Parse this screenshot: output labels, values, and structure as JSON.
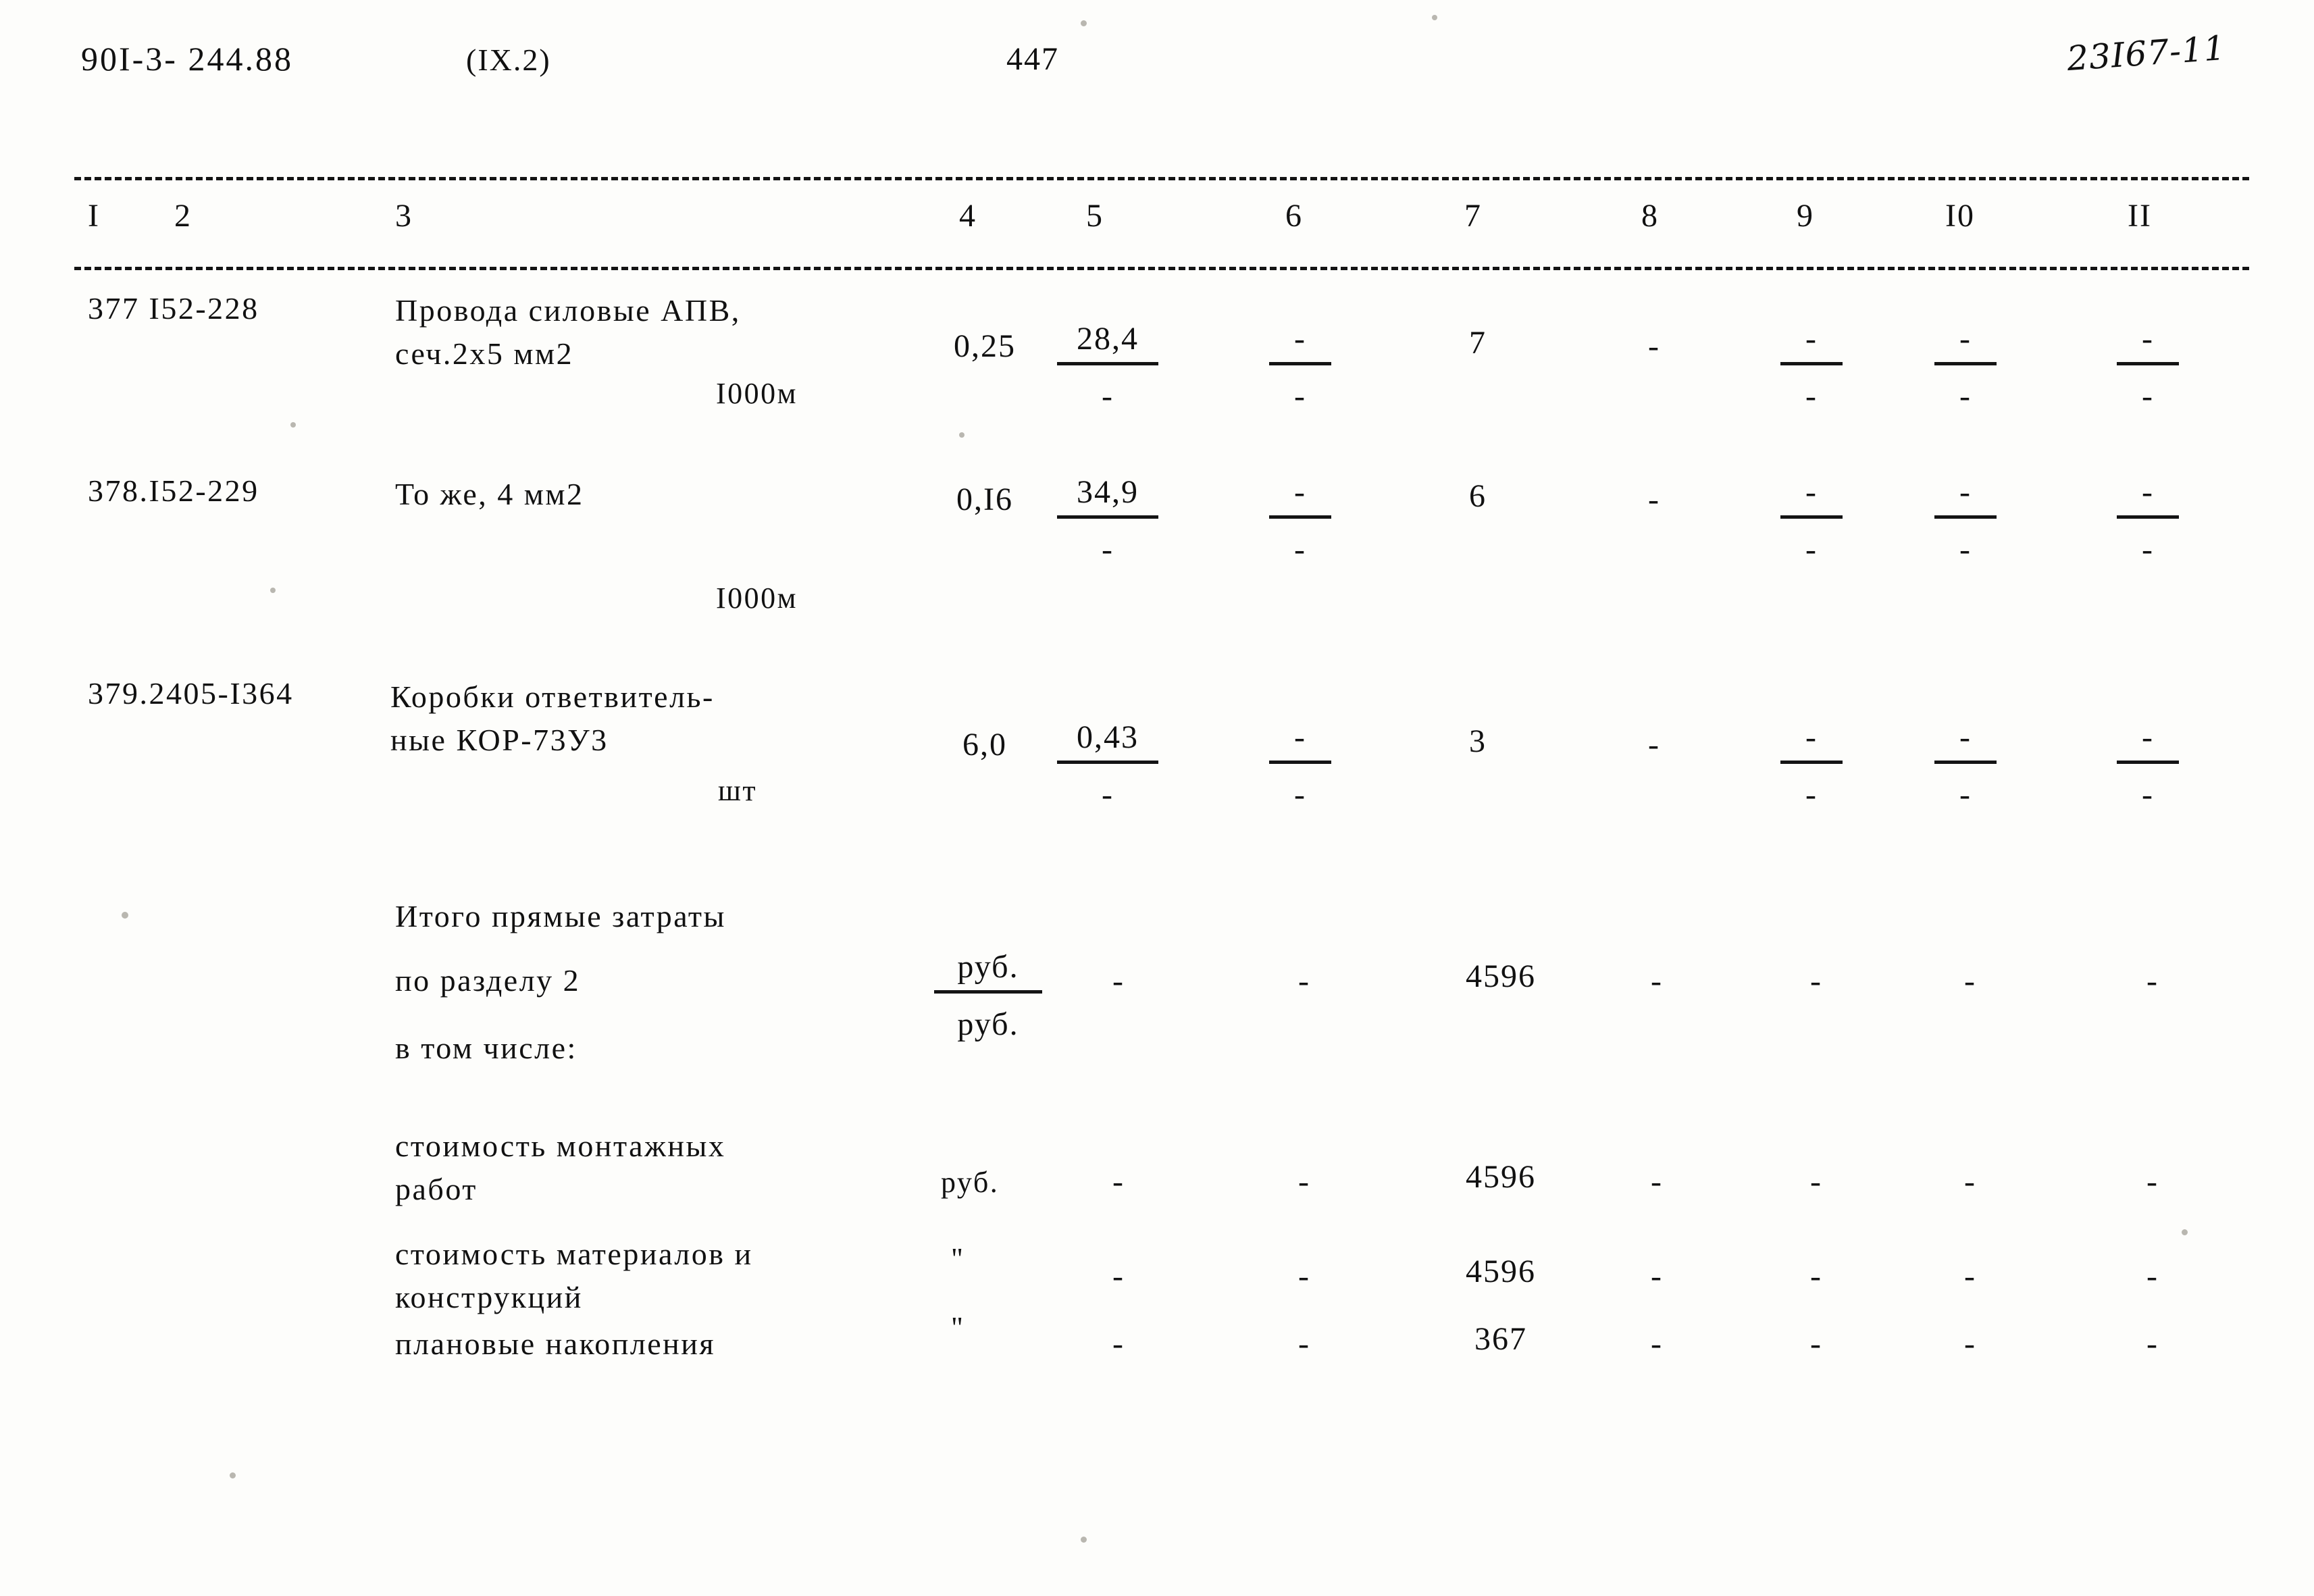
{
  "header": {
    "doc_code": "90I-3- 244.88",
    "section": "(IX.2)",
    "page_number": "447",
    "handwritten_note": "23I67-11"
  },
  "table": {
    "column_headers": [
      "I",
      "2",
      "3",
      "4",
      "5",
      "6",
      "7",
      "8",
      "9",
      "I0",
      "II"
    ],
    "rows": [
      {
        "code": "377 I52-228",
        "description": "Провода силовые АПВ,\nсеч.2х5 мм2",
        "unit": "I000м",
        "col4": "0,25",
        "col5_top": "28,4",
        "col5_bot": "-",
        "col6_top": "-",
        "col6_bot": "-",
        "col7": "7",
        "col8": "-",
        "col9_top": "-",
        "col9_bot": "-",
        "col10_top": "-",
        "col10_bot": "-",
        "col11_top": "-",
        "col11_bot": "-"
      },
      {
        "code": "378.I52-229",
        "description": "То же, 4 мм2",
        "unit": "I000м",
        "col4": "0,I6",
        "col5_top": "34,9",
        "col5_bot": "-",
        "col6_top": "-",
        "col6_bot": "-",
        "col7": "6",
        "col8": "-",
        "col9_top": "-",
        "col9_bot": "-",
        "col10_top": "-",
        "col10_bot": "-",
        "col11_top": "-",
        "col11_bot": "-"
      },
      {
        "code": "379.2405-I364",
        "description": "Коробки ответвитель-\nные КОР-73У3",
        "unit": "шт",
        "col4": "6,0",
        "col5_top": "0,43",
        "col5_bot": "-",
        "col6_top": "-",
        "col6_bot": "-",
        "col7": "3",
        "col8": "-",
        "col9_top": "-",
        "col9_bot": "-",
        "col10_top": "-",
        "col10_bot": "-",
        "col11_top": "-",
        "col11_bot": "-"
      }
    ],
    "summary": {
      "total_label_line1": "Итого прямые затраты",
      "total_label_line2": "по разделу 2",
      "total_unit_top": "руб.",
      "total_unit_bot": "руб.",
      "total_col5": "-",
      "total_col6": "-",
      "total_col7": "4596",
      "total_col8": "-",
      "total_col9": "-",
      "total_col10": "-",
      "total_col11": "-",
      "including_label": "в том числе:",
      "items": [
        {
          "label": "стоимость монтажных\nработ",
          "unit": "руб.",
          "col5": "-",
          "col6": "-",
          "col7": "4596",
          "col8": "-",
          "col9": "-",
          "col10": "-",
          "col11": "-"
        },
        {
          "label": "стоимость материалов и\nконструкций",
          "unit": "\"",
          "col5": "-",
          "col6": "-",
          "col7": "4596",
          "col8": "-",
          "col9": "-",
          "col10": "-",
          "col11": "-"
        },
        {
          "label": "плановые накопления",
          "unit": "\"",
          "col5": "-",
          "col6": "-",
          "col7": "367",
          "col8": "-",
          "col9": "-",
          "col10": "-",
          "col11": "-"
        }
      ]
    }
  }
}
